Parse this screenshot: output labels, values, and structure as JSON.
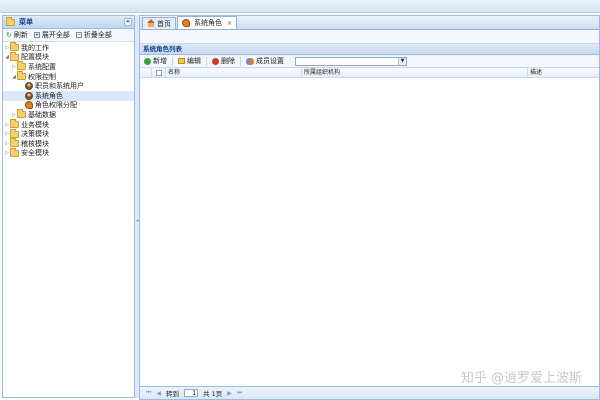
{
  "sidebar": {
    "title": "菜单",
    "collapse_glyph": "«",
    "tools": {
      "refresh": "刷新",
      "expand_all": "展开全部",
      "collapse_all": "折叠全部"
    },
    "tree": [
      {
        "label": "我的工作",
        "level": 0,
        "expanded": false,
        "icon": "folder-icon"
      },
      {
        "label": "配置模块",
        "level": 0,
        "expanded": true,
        "icon": "folder-icon"
      },
      {
        "label": "系统配置",
        "level": 1,
        "expanded": false,
        "icon": "folder-icon"
      },
      {
        "label": "权限控制",
        "level": 1,
        "expanded": true,
        "icon": "folder-icon"
      },
      {
        "label": "职员和系统用户",
        "level": 2,
        "icon": "user-icon"
      },
      {
        "label": "系统角色",
        "level": 2,
        "icon": "user-icon",
        "selected": true
      },
      {
        "label": "角色权限分配",
        "level": 2,
        "icon": "key-icon"
      },
      {
        "label": "基础数据",
        "level": 1,
        "expanded": false,
        "icon": "folder-icon"
      },
      {
        "label": "业务模块",
        "level": 0,
        "expanded": false,
        "icon": "folder-icon"
      },
      {
        "label": "决策模块",
        "level": 0,
        "expanded": false,
        "icon": "folder-icon"
      },
      {
        "label": "稽核模块",
        "level": 0,
        "expanded": false,
        "icon": "folder-icon"
      },
      {
        "label": "安全模块",
        "level": 0,
        "expanded": false,
        "icon": "folder-icon"
      }
    ]
  },
  "tabs": [
    {
      "label": "首页",
      "icon": "home-icon",
      "active": false
    },
    {
      "label": "系统角色",
      "icon": "key-icon",
      "active": true,
      "closable": "×"
    }
  ],
  "grid": {
    "title": "系统角色列表",
    "toolbar": {
      "add": "新增",
      "edit": "编辑",
      "delete": "删除",
      "members": "成员设置"
    },
    "search_value": "",
    "columns": {
      "name": "名称",
      "org": "所属组织机构",
      "desc": "描述"
    }
  },
  "pager": {
    "first": "⏮",
    "prev": "◀",
    "goto_label": "转到",
    "page": "1",
    "total": "共 1页",
    "next": "▶",
    "last": "⏭"
  },
  "watermark": "知乎 @逍罗爱上波斯"
}
